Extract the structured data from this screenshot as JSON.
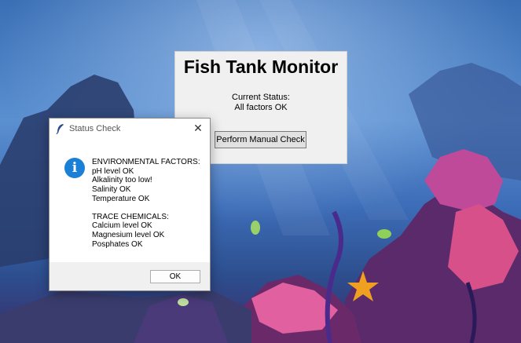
{
  "main_window": {
    "title": "Fish Tank Monitor",
    "status_label": "Current Status:",
    "status_value": "All factors OK",
    "manual_check_button": "Perform Manual Check"
  },
  "dialog": {
    "title": "Status Check",
    "icon": "info-icon",
    "environmental_header": "ENVIRONMENTAL FACTORS:",
    "environmental_items": [
      "pH level OK",
      "Alkalinity too low!",
      "Salinity OK",
      "Temperature OK"
    ],
    "trace_header": "TRACE CHEMICALS:",
    "trace_items": [
      "Calcium level OK",
      "Magnesium level OK",
      "Posphates OK"
    ],
    "ok_button": "OK"
  },
  "colors": {
    "info_icon": "#1a7fd6",
    "dialog_footer": "#f0f0f0"
  }
}
